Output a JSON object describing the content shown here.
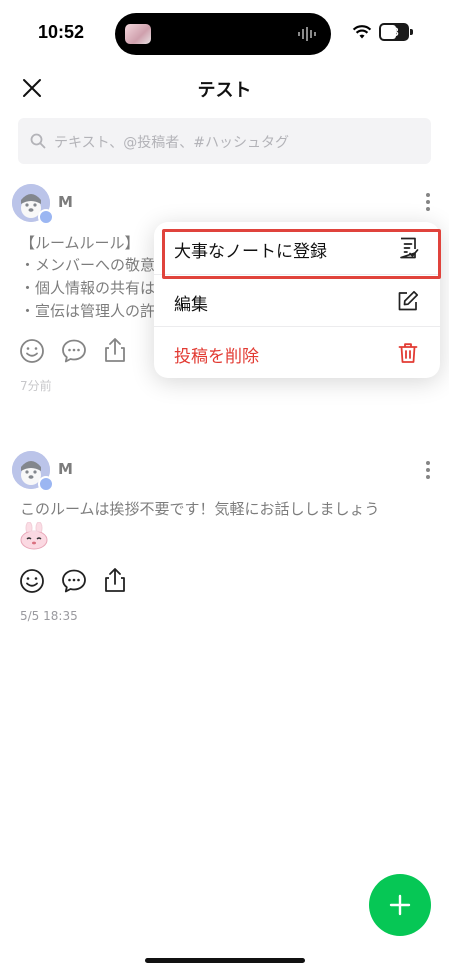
{
  "status_bar": {
    "time": "10:52",
    "battery": "53"
  },
  "header": {
    "title": "テスト"
  },
  "search": {
    "placeholder": "テキスト、@投稿者、#ハッシュタグ"
  },
  "posts": [
    {
      "author": "M",
      "lines": [
        "【ルームルール】",
        "・メンバーへの敬意",
        "・個人情報の共有は",
        "・宣伝は管理人の許"
      ],
      "timestamp": "7分前"
    },
    {
      "author": "M",
      "lines": [
        "このルームは挨拶不要です！気軽にお話ししましょう"
      ],
      "timestamp": "5/5 18:35"
    }
  ],
  "menu": {
    "items": [
      {
        "label": "大事なノートに登録",
        "icon": "note-check-icon"
      },
      {
        "label": "編集",
        "icon": "edit-icon"
      },
      {
        "label": "投稿を削除",
        "icon": "trash-icon",
        "danger": true
      }
    ]
  },
  "colors": {
    "accent_green": "#06c755",
    "danger_red": "#e23b33",
    "highlight": "#e0433c"
  }
}
